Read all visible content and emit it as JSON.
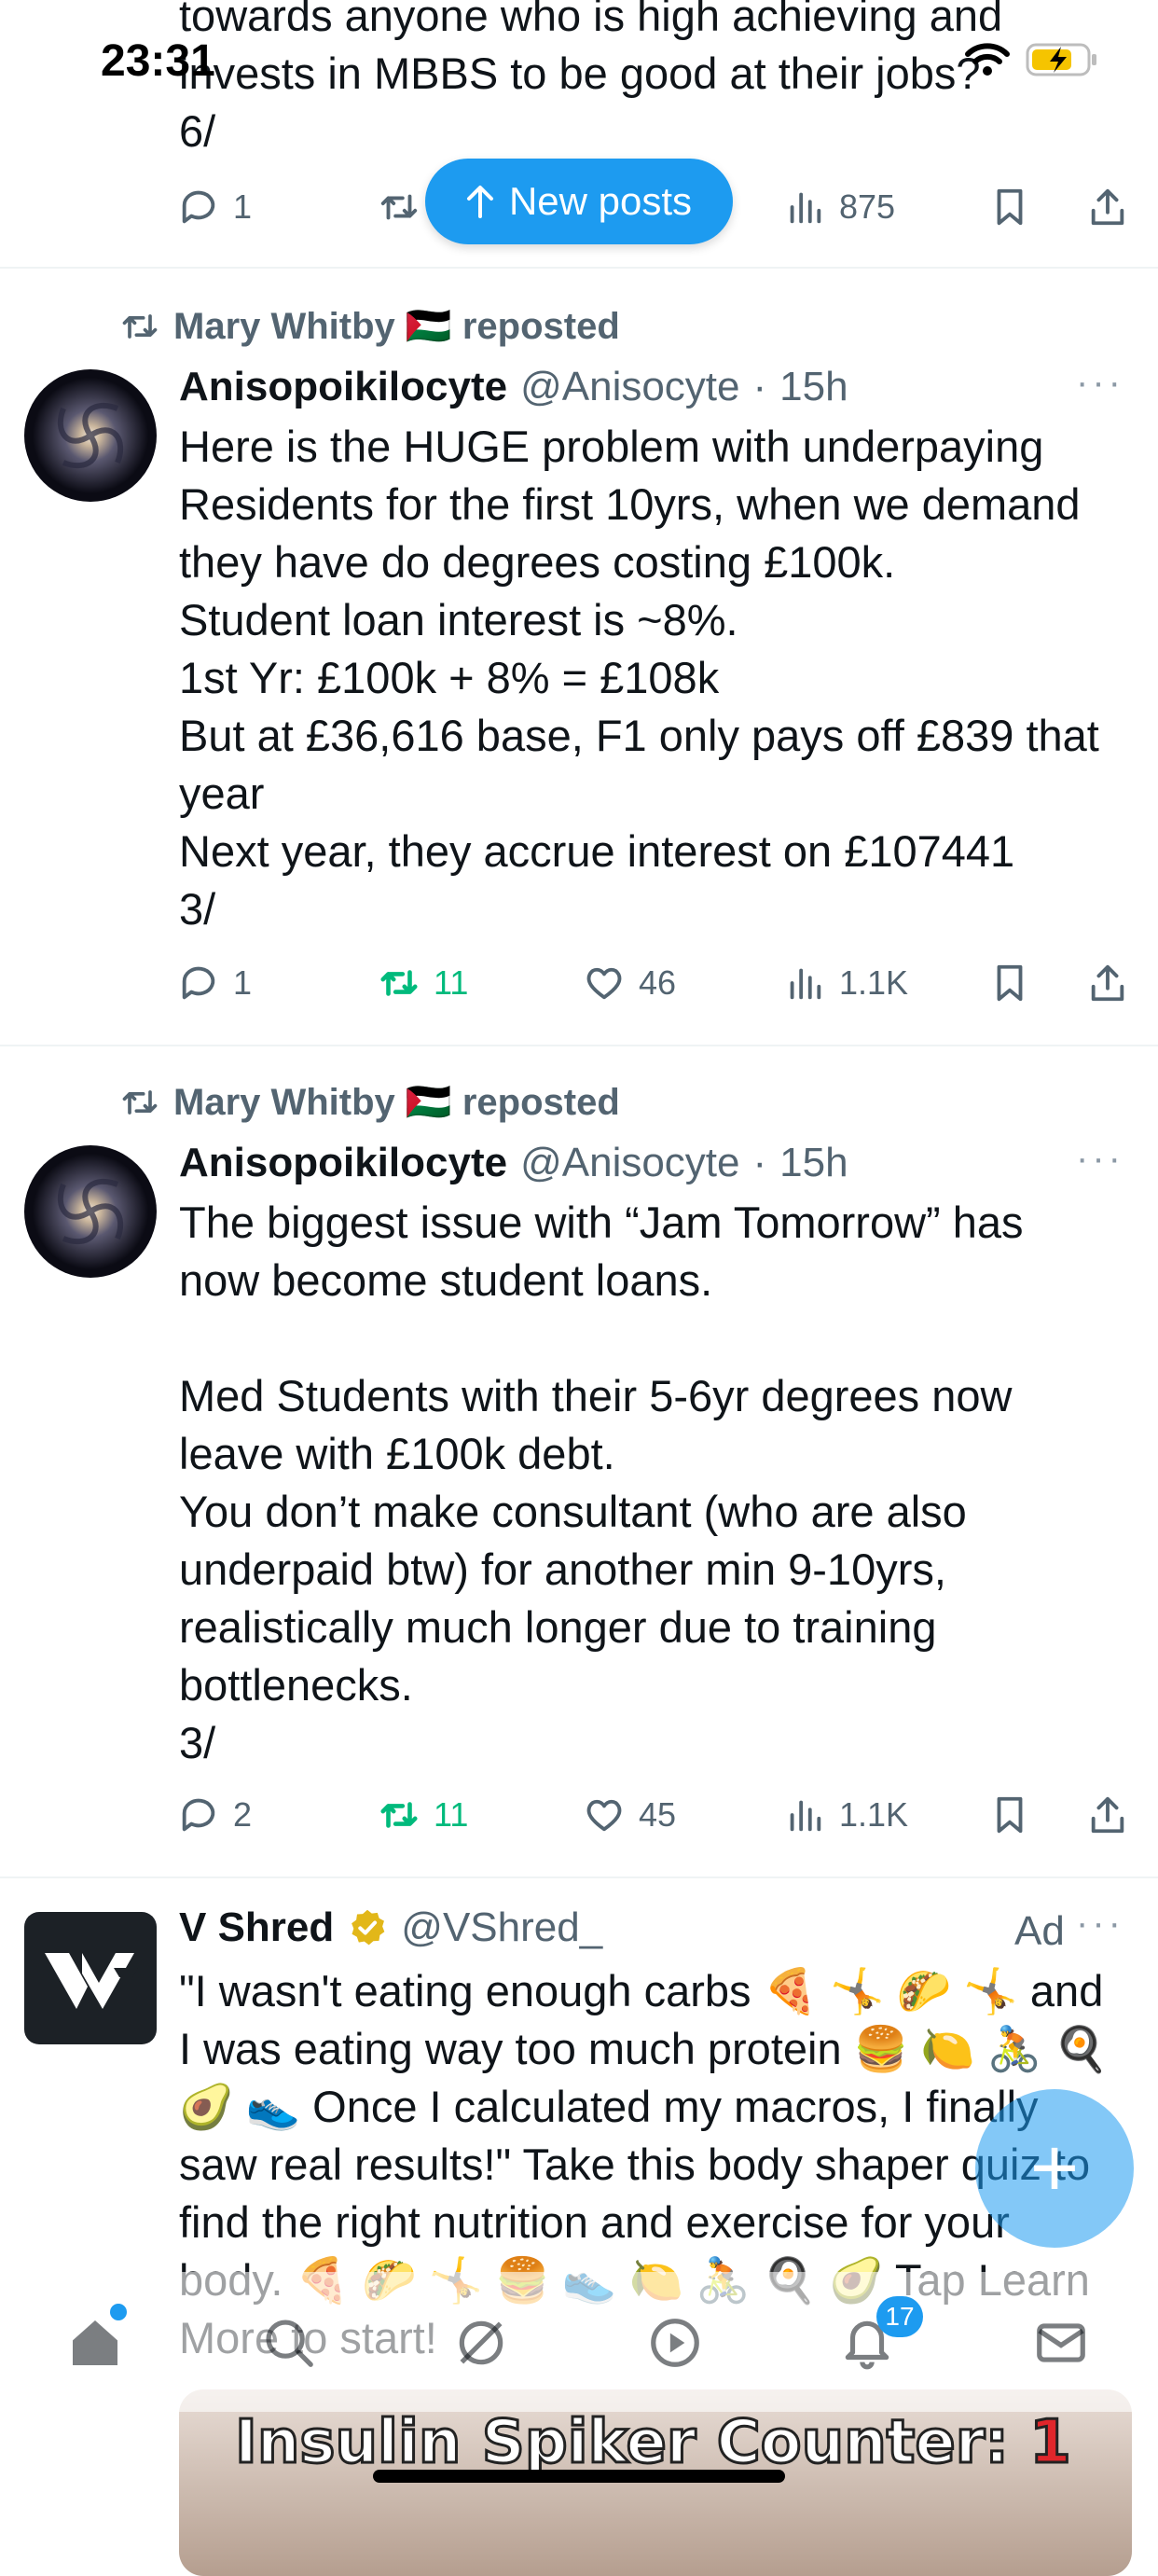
{
  "status_bar": {
    "time": "23:31"
  },
  "new_posts_label": "New posts",
  "tweets": [
    {
      "text": "towards anyone who is high achieving and\ninvests in MBBS to be good at their jobs?\n6/",
      "actions": {
        "replies": "1",
        "views": "875"
      }
    },
    {
      "repost_by": "Mary Whitby 🇵🇸 reposted",
      "name": "Anisopoikilocyte",
      "handle": "@Anisocyte",
      "time": "15h",
      "text": "Here is the HUGE problem with underpaying\nResidents for the first 10yrs, when we demand\nthey have do degrees costing £100k.\nStudent loan interest is ~8%.\n1st Yr: £100k + 8% = £108k\nBut at £36,616 base, F1 only pays off £839 that\nyear\nNext year, they accrue interest on £107441\n3/",
      "actions": {
        "replies": "1",
        "reposts": "11",
        "likes": "46",
        "views": "1.1K"
      }
    },
    {
      "repost_by": "Mary Whitby 🇵🇸 reposted",
      "name": "Anisopoikilocyte",
      "handle": "@Anisocyte",
      "time": "15h",
      "text": "The biggest issue with “Jam Tomorrow” has\nnow become student loans.\n\nMed Students with their 5-6yr degrees now\nleave with £100k debt.\nYou don’t make consultant (who are also\nunderpaid btw) for another min 9-10yrs,\nrealistically much longer due to training\nbottlenecks.\n3/",
      "actions": {
        "replies": "2",
        "reposts": "11",
        "likes": "45",
        "views": "1.1K"
      }
    },
    {
      "name": "V Shred",
      "handle": "@VShred_",
      "ad_label": "Ad",
      "text": "\"I wasn't eating enough carbs 🍕 🤸 🌮 🤸 and\nI was eating way too much protein 🍔 🍋 🚴 🍳\n🥑 👟 Once I calculated my macros, I finally\nsaw real results!\" Take this body shaper quiz to\nfind the right nutrition and exercise for your\nbody. 🍕 🌮 🤸 🍔 👟 🍋 🚴 🍳 🥑 Tap Learn\nMore to start!",
      "media_text_prefix": "Insulin Spiker Counter: ",
      "media_text_count": "1"
    }
  ],
  "tabbar": {
    "notification_count": "17"
  },
  "colors": {
    "accent": "#1d9bf0",
    "repost_green": "#00ba7c",
    "muted": "#536471"
  }
}
